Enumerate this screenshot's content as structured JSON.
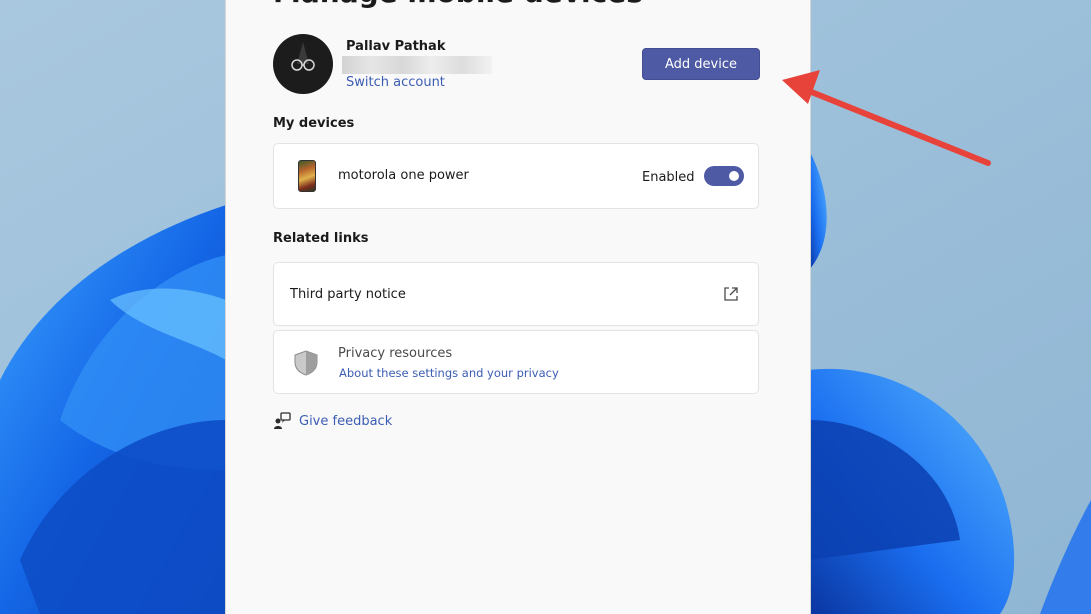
{
  "page": {
    "title": "Manage mobile devices"
  },
  "account": {
    "name": "Pallav Pathak",
    "switch_label": "Switch account",
    "add_device_label": "Add device"
  },
  "devices": {
    "section_label": "My devices",
    "items": [
      {
        "name": "motorola one power",
        "status_label": "Enabled",
        "enabled": true
      }
    ]
  },
  "related_links": {
    "section_label": "Related links",
    "third_party_notice": "Third party notice",
    "privacy_title": "Privacy resources",
    "privacy_link": "About these settings and your privacy"
  },
  "feedback": {
    "label": "Give feedback"
  },
  "icons": {
    "external_link": "external-link-icon",
    "shield": "shield-icon",
    "feedback": "feedback-icon",
    "annotation_arrow": "red-arrow"
  },
  "colors": {
    "accent": "#4e5aa4",
    "link": "#3b5db3",
    "arrow": "#e8433a"
  }
}
